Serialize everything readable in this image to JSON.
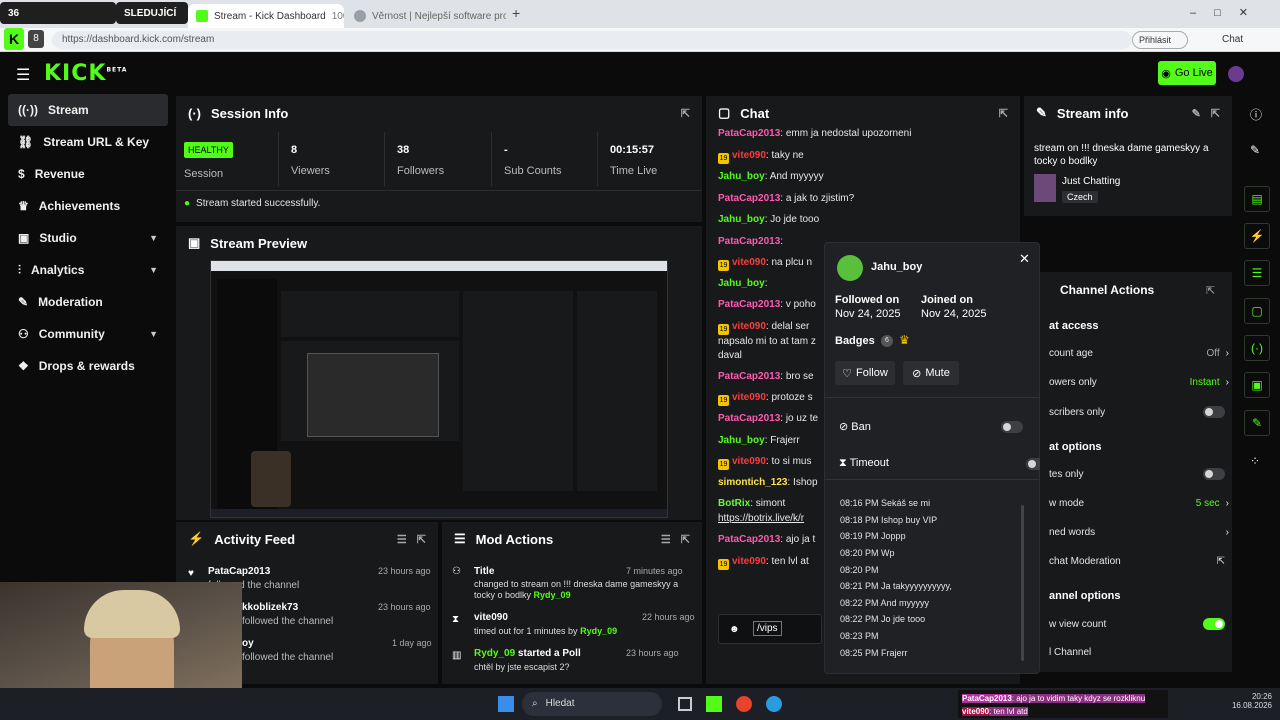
{
  "browser": {
    "tabs": [
      {
        "label": "36",
        "color": "#f7f7f7"
      },
      {
        "label": "SLEDUJÍCÍ",
        "color": "#f7f7f7"
      },
      {
        "label": "Stream - Kick Dashboard",
        "badge": "100",
        "color": "#53fc18"
      },
      {
        "label": "Věrnost | Nejlepší software pro vyle",
        "color": "#9aa0a6"
      }
    ],
    "url": "https://dashboard.kick.com/stream",
    "signin_label": "Přihlásit",
    "chat_label": "Chat"
  },
  "app": {
    "logo": "KICK",
    "logo_sup": "BETA",
    "go_live_label": "Go Live",
    "accent": "#53fc18"
  },
  "sidebar": {
    "items": [
      {
        "label": "Stream",
        "icon": "signal-icon",
        "active": true
      },
      {
        "label": "Stream URL & Key",
        "icon": "link-icon"
      },
      {
        "label": "Revenue",
        "icon": "dollar-icon"
      },
      {
        "label": "Achievements",
        "icon": "trophy-icon"
      },
      {
        "label": "Studio",
        "icon": "studio-icon",
        "chevron": true
      },
      {
        "label": "Analytics",
        "icon": "chart-icon",
        "chevron": true
      },
      {
        "label": "Moderation",
        "icon": "wrench-icon"
      },
      {
        "label": "Community",
        "icon": "community-icon",
        "chevron": true
      },
      {
        "label": "Drops & rewards",
        "icon": "gift-icon"
      }
    ]
  },
  "session": {
    "title": "Session Info",
    "status": "HEALTHY",
    "status_label": "Session",
    "stats": [
      {
        "value": "8",
        "label": "Viewers"
      },
      {
        "value": "38",
        "label": "Followers"
      },
      {
        "value": "-",
        "label": "Sub Counts"
      },
      {
        "value": "00:15:57",
        "label": "Time Live"
      }
    ],
    "message": "Stream started successfully."
  },
  "preview": {
    "title": "Stream Preview"
  },
  "activity": {
    "title": "Activity Feed",
    "items": [
      {
        "user": "PataCap2013",
        "text": "followed the channel",
        "time": "23 hours ago"
      },
      {
        "user": "kkoblizek73",
        "text": "followed the channel",
        "time": "23 hours ago"
      },
      {
        "user": "oy",
        "text": "followed the channel",
        "time": "1 day ago"
      }
    ]
  },
  "mod_actions": {
    "title": "Mod Actions",
    "items": [
      {
        "title": "Title",
        "text": "changed to stream on !!! dneska dame gameskyy a tocky o bodlky",
        "by": "Rydy_09",
        "time": "7 minutes ago"
      },
      {
        "title": "vite090",
        "text": "timed out for 1 minutes by",
        "by": "Rydy_09",
        "time": "22 hours ago"
      },
      {
        "title": "Rydy_09",
        "text_after": "started a Poll",
        "sub": "chtěl by jste escapist 2?",
        "time": "23 hours ago"
      }
    ]
  },
  "chat": {
    "title": "Chat",
    "input_value": "/vips",
    "messages": [
      {
        "user": "PataCap2013",
        "cls": "u-pink",
        "text": "emm ja nedostal upozorneni"
      },
      {
        "user": "vite090",
        "cls": "u-red",
        "badge": "19",
        "text": "taky ne"
      },
      {
        "user": "Jahu_boy",
        "cls": "u-green",
        "text": "And myyyyy"
      },
      {
        "user": "PataCap2013",
        "cls": "u-pink",
        "text": "a jak to zjistim?"
      },
      {
        "user": "Jahu_boy",
        "cls": "u-green",
        "text": "Jo jde tooo"
      },
      {
        "user": "PataCap2013",
        "cls": "u-pink",
        "text": ""
      },
      {
        "user": "vite090",
        "cls": "u-red",
        "badge": "19",
        "text": "na plcu n"
      },
      {
        "user": "Jahu_boy",
        "cls": "u-green",
        "text": ""
      },
      {
        "user": "PataCap2013",
        "cls": "u-pink",
        "text": "v poho"
      },
      {
        "user": "vite090",
        "cls": "u-red",
        "badge": "19",
        "text": "delal ser"
      },
      {
        "user": "",
        "cls": "",
        "text": "napsalo mi to at tam z"
      },
      {
        "user": "",
        "cls": "",
        "text": "daval"
      },
      {
        "user": "PataCap2013",
        "cls": "u-pink",
        "text": "bro se"
      },
      {
        "user": "vite090",
        "cls": "u-red",
        "badge": "19",
        "text": "protoze s"
      },
      {
        "user": "PataCap2013",
        "cls": "u-pink",
        "text": "jo uz te"
      },
      {
        "user": "Jahu_boy",
        "cls": "u-green",
        "text": "Frajerr"
      },
      {
        "user": "vite090",
        "cls": "u-red",
        "badge": "19",
        "text": "to si mus"
      },
      {
        "user": "simontich_123",
        "cls": "u-yel",
        "text": "Ishop"
      },
      {
        "user": "BotRix",
        "cls": "u-lime",
        "text": "simont"
      },
      {
        "user": "",
        "cls": "",
        "text": "https://botrix.live/k/r"
      },
      {
        "user": "PataCap2013",
        "cls": "u-pink",
        "text": "ajo ja t"
      },
      {
        "user": "vite090",
        "cls": "u-red",
        "badge": "19",
        "text": "ten lvl at"
      }
    ]
  },
  "user_card": {
    "username": "Jahu_boy",
    "followed_label": "Followed on",
    "followed_date": "Nov 24, 2025",
    "joined_label": "Joined on",
    "joined_date": "Nov 24, 2025",
    "badges_label": "Badges",
    "follow_label": "Follow",
    "mute_label": "Mute",
    "ban_label": "Ban",
    "timeout_label": "Timeout",
    "history": [
      {
        "time": "08:16 PM",
        "text": "Sekáš se mi"
      },
      {
        "time": "08:18 PM",
        "text": "Ishop buy VIP"
      },
      {
        "time": "08:19 PM",
        "text": "Joppp"
      },
      {
        "time": "08:20 PM",
        "text": "Wp"
      },
      {
        "time": "08:20 PM",
        "text": ""
      },
      {
        "time": "08:21 PM",
        "text": "Ja takyyyyyyyyyy,"
      },
      {
        "time": "08:22 PM",
        "text": "And myyyyy"
      },
      {
        "time": "08:22 PM",
        "text": "Jo jde tooo"
      },
      {
        "time": "08:23 PM",
        "text": ""
      },
      {
        "time": "08:25 PM",
        "text": "Frajerr"
      }
    ]
  },
  "stream_info": {
    "title": "Stream info",
    "stream_title": "stream on !!! dneska dame gameskyy a tocky o bodlky",
    "category": "Just Chatting",
    "language": "Czech"
  },
  "channel_actions": {
    "title": "Channel Actions",
    "sec1": "at access",
    "row1": "count age",
    "row1_val": "Off",
    "row2": "owers only",
    "row2_val": "Instant",
    "row3": "scribers only",
    "sec2": "at options",
    "row4": "tes only",
    "row5": "w mode",
    "row5_val": "5 sec",
    "row6": "ned words",
    "row7": "chat Moderation",
    "sec3": "annel options",
    "row8": "w view count",
    "row9": "l Channel"
  },
  "taskbar": {
    "search_placeholder": "Hledat",
    "time": "20:26",
    "date": "16.08.2026",
    "overlay": [
      {
        "user": "PataCap2013",
        "text": ": ajo ja to vidim taky kdyz se rozkliknu"
      },
      {
        "user": "vite090",
        "text": ": ten lvl atd"
      }
    ]
  }
}
